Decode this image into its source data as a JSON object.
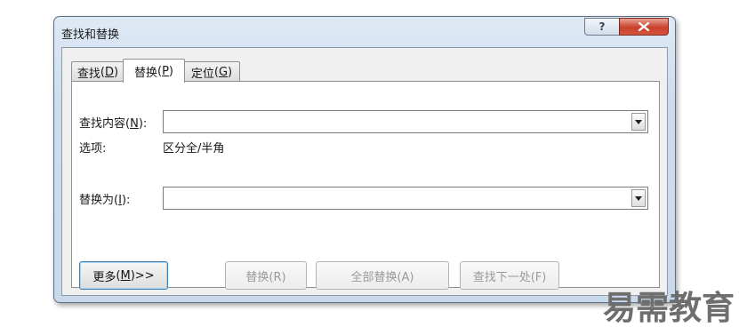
{
  "dialog": {
    "title": "查找和替换",
    "help_symbol": "?",
    "tabs": [
      {
        "label": "查找",
        "key": "D",
        "active": false
      },
      {
        "label": "替换",
        "key": "P",
        "active": true
      },
      {
        "label": "定位",
        "key": "G",
        "active": false
      }
    ],
    "find": {
      "label": "查找内容",
      "key": "N",
      "value": ""
    },
    "options": {
      "label": "选项:",
      "value": "区分全/半角"
    },
    "replace": {
      "label": "替换为",
      "key": "I",
      "value": ""
    },
    "buttons": {
      "more": {
        "label": "更多",
        "key": "M",
        "suffix": " >>"
      },
      "replace": "替换(R)",
      "replace_all": "全部替换(A)",
      "find_next": "查找下一处(F)"
    }
  },
  "watermark": "易需教育"
}
